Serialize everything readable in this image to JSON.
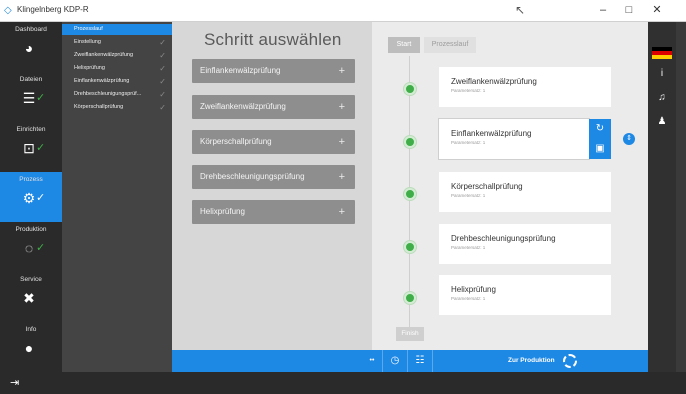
{
  "window": {
    "title": "Klingelnberg KDP-R",
    "minimize": "–",
    "maximize": "□",
    "close": "✕"
  },
  "nav": [
    {
      "label": "Dashboard",
      "icon": "gauge-icon",
      "glyph": "◕",
      "check": false,
      "active": false
    },
    {
      "label": "Dateien",
      "icon": "file-list-icon",
      "glyph": "☰",
      "check": true,
      "active": false
    },
    {
      "label": "Einrichten",
      "icon": "setup-icon",
      "glyph": "⊡",
      "check": true,
      "active": false
    },
    {
      "label": "Prozess",
      "icon": "gears-icon",
      "glyph": "⚙",
      "check": true,
      "active": true
    },
    {
      "label": "Produktion",
      "icon": "cycle-icon",
      "glyph": "◌",
      "check": true,
      "active": false
    },
    {
      "label": "Service",
      "icon": "tools-icon",
      "glyph": "✖",
      "check": false,
      "active": false
    },
    {
      "label": "Info",
      "icon": "info-icon",
      "glyph": "●",
      "check": false,
      "active": false
    }
  ],
  "submenu": [
    {
      "label": "Prozesslauf",
      "active": true
    },
    {
      "label": "Einstellung",
      "active": false
    },
    {
      "label": "Zweiflankenwälzprüfung",
      "active": false
    },
    {
      "label": "Helixprüfung",
      "active": false
    },
    {
      "label": "Einflankenwälzprüfung",
      "active": false
    },
    {
      "label": "Drehbeschleunigungsprüf...",
      "active": false
    },
    {
      "label": "Körperschallprüfung",
      "active": false
    }
  ],
  "middle": {
    "heading": "Schritt auswählen",
    "steps": [
      "Einflankenwälzprüfung",
      "Zweiflankenwälzprüfung",
      "Körperschallprüfung",
      "Drehbeschleunigungsprüfung",
      "Helixprüfung"
    ],
    "plus": "+"
  },
  "flow": {
    "tab_start": "Start",
    "tab_process": "Prozesslauf",
    "tab_finish": "Finish",
    "cards": [
      {
        "title": "Zweiflankenwälzprüfung",
        "sub": "Parametersatz: 1"
      },
      {
        "title": "Einflankenwälzprüfung",
        "sub": "Parametersatz: 1",
        "selected": true
      },
      {
        "title": "Körperschallprüfung",
        "sub": "Parametersatz: 1"
      },
      {
        "title": "Drehbeschleunigungsprüfung",
        "sub": "Parametersatz: 1"
      },
      {
        "title": "Helixprüfung",
        "sub": "Parametersatz: 1"
      }
    ]
  },
  "actionbar": {
    "expand": "••",
    "go_production": "Zur Produktion"
  },
  "colors": {
    "accent": "#1e88e5",
    "success": "#3fae49"
  }
}
